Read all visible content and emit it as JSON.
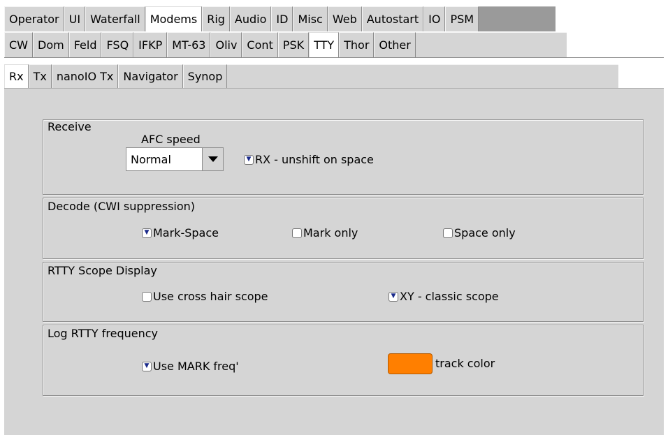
{
  "tabs_level1": [
    "Operator",
    "UI",
    "Waterfall",
    "Modems",
    "Rig",
    "Audio",
    "ID",
    "Misc",
    "Web",
    "Autostart",
    "IO",
    "PSM"
  ],
  "tabs_level1_selected": "Modems",
  "tabs_level2": [
    "CW",
    "Dom",
    "Feld",
    "FSQ",
    "IFKP",
    "MT-63",
    "Oliv",
    "Cont",
    "PSK",
    "TTY",
    "Thor",
    "Other"
  ],
  "tabs_level2_selected": "TTY",
  "tabs_level3": [
    "Rx",
    "Tx",
    "nanoIO Tx",
    "Navigator",
    "Synop"
  ],
  "tabs_level3_selected": "Rx",
  "receive": {
    "title": "Receive",
    "afc_label": "AFC speed",
    "afc_value": "Normal",
    "unshift_label": "RX - unshift on space",
    "unshift_checked": true
  },
  "decode": {
    "title": "Decode (CWI suppression)",
    "mark_space_label": "Mark-Space",
    "mark_space_checked": true,
    "mark_only_label": "Mark only",
    "mark_only_checked": false,
    "space_only_label": "Space only",
    "space_only_checked": false
  },
  "scope": {
    "title": "RTTY Scope Display",
    "cross_hair_label": "Use cross hair scope",
    "cross_hair_checked": false,
    "xy_label": "XY - classic scope",
    "xy_checked": true
  },
  "log": {
    "title": "Log RTTY frequency",
    "mark_freq_label": "Use MARK freq'",
    "mark_freq_checked": true,
    "track_color_label": "track color",
    "track_color": "#ff7f00"
  }
}
